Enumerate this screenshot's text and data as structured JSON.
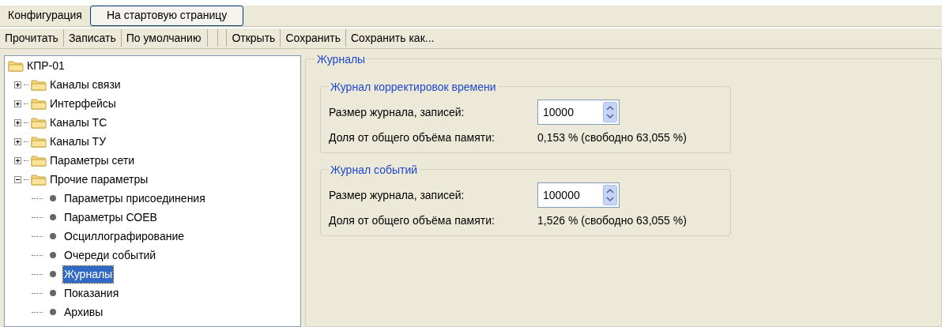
{
  "menu": {
    "label": "Конфигурация",
    "home_button": "На стартовую страницу"
  },
  "toolbar_groups": [
    [
      "Прочитать",
      "Записать",
      "По умолчанию"
    ],
    [
      "Открыть",
      "Сохранить",
      "Сохранить как..."
    ]
  ],
  "tree": {
    "label": "КПР-01",
    "kind": "folder",
    "selected": false,
    "children": [
      {
        "label": "Каналы связи",
        "kind": "folder",
        "expanded": false,
        "selected": false
      },
      {
        "label": "Интерфейсы",
        "kind": "folder",
        "expanded": false,
        "selected": false
      },
      {
        "label": "Каналы ТС",
        "kind": "folder",
        "expanded": false,
        "selected": false
      },
      {
        "label": "Каналы ТУ",
        "kind": "folder",
        "expanded": false,
        "selected": false
      },
      {
        "label": "Параметры сети",
        "kind": "folder",
        "expanded": false,
        "selected": false
      },
      {
        "label": "Прочие параметры",
        "kind": "folder",
        "expanded": true,
        "selected": false,
        "children": [
          {
            "label": "Параметры присоединения",
            "kind": "leaf",
            "selected": false
          },
          {
            "label": "Параметры СОЕВ",
            "kind": "leaf",
            "selected": false
          },
          {
            "label": "Осциллографирование",
            "kind": "leaf",
            "selected": false
          },
          {
            "label": "Очереди событий",
            "kind": "leaf",
            "selected": false
          },
          {
            "label": "Журналы",
            "kind": "leaf",
            "selected": true
          },
          {
            "label": "Показания",
            "kind": "leaf",
            "selected": false
          },
          {
            "label": "Архивы",
            "kind": "leaf",
            "selected": false
          }
        ]
      }
    ]
  },
  "panel": {
    "title": "Журналы",
    "groups": [
      {
        "title": "Журнал корректировок времени",
        "size_label": "Размер журнала, записей:",
        "size_value": "10000",
        "share_label": "Доля от общего объёма памяти:",
        "share_value": "0,153 % (свободно 63,055 %)"
      },
      {
        "title": "Журнал событий",
        "size_label": "Размер журнала, записей:",
        "size_value": "100000",
        "share_label": "Доля от общего объёма памяти:",
        "share_value": "1,526 % (свободно 63,055 %)"
      }
    ]
  }
}
